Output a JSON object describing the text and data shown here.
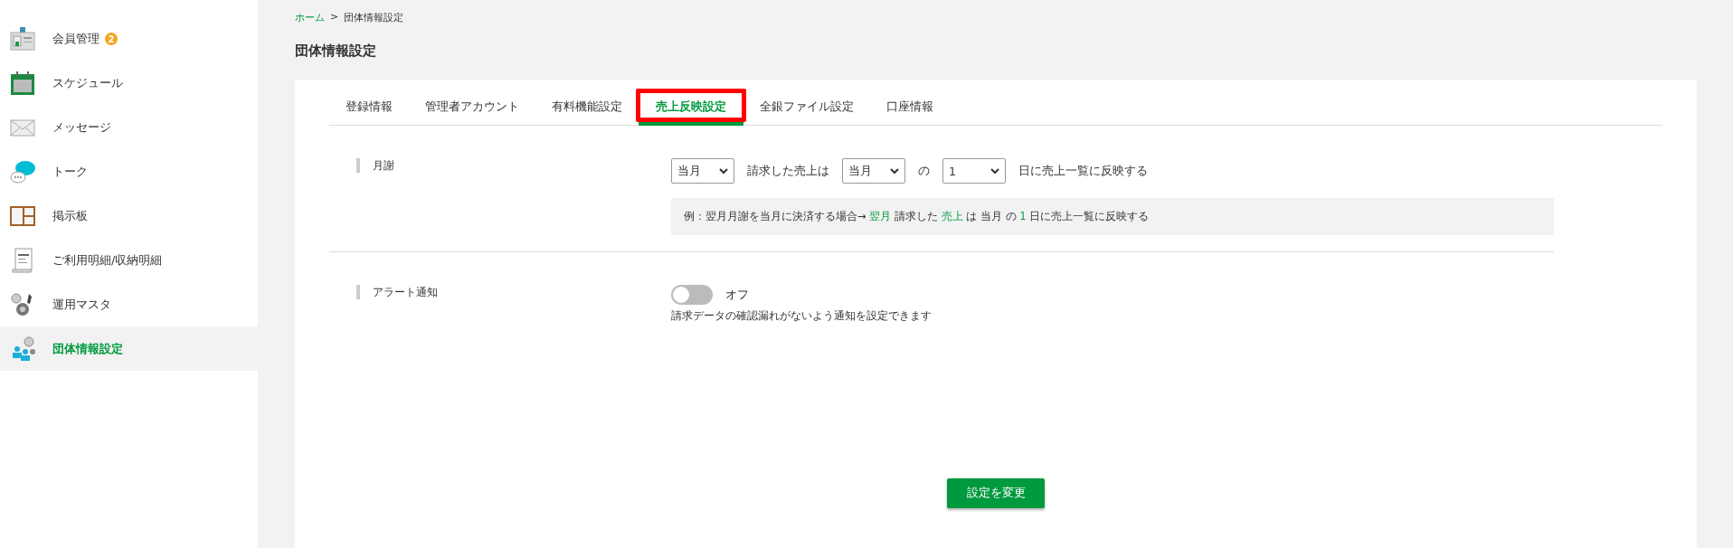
{
  "sidebar": {
    "items": [
      {
        "kind": "idcard",
        "label": "会員管理",
        "badge": "2",
        "selected": false
      },
      {
        "kind": "calendar",
        "label": "スケジュール",
        "selected": false
      },
      {
        "kind": "envelope",
        "label": "メッセージ",
        "selected": false
      },
      {
        "kind": "chat",
        "label": "トーク",
        "selected": false
      },
      {
        "kind": "board",
        "label": "掲示板",
        "selected": false
      },
      {
        "kind": "receipt",
        "label": "ご利用明細/収納明細",
        "selected": false
      },
      {
        "kind": "gears",
        "label": "運用マスタ",
        "selected": false
      },
      {
        "kind": "group",
        "label": "団体情報設定",
        "selected": true
      }
    ]
  },
  "breadcrumb": {
    "link": "ホーム",
    "separator": ">",
    "current": "団体情報設定"
  },
  "page_title": "団体情報設定",
  "tabs": [
    {
      "label": "登録情報",
      "selected": false,
      "highlighted": false
    },
    {
      "label": "管理者アカウント",
      "selected": false,
      "highlighted": false
    },
    {
      "label": "有料機能設定",
      "selected": false,
      "highlighted": false
    },
    {
      "label": "売上反映設定",
      "selected": true,
      "highlighted": true
    },
    {
      "label": "全銀ファイル設定",
      "selected": false,
      "highlighted": false
    },
    {
      "label": "口座情報",
      "selected": false,
      "highlighted": false
    }
  ],
  "monthly": {
    "label": "月謝",
    "select_1": "当月",
    "text_1": "請求した売上は",
    "select_2": "当月",
    "text_2": "の",
    "select_3": "1",
    "text_3": "日に売上一覧に反映する",
    "example": [
      {
        "text": "例：翌月月謝を当月に決済する場合→ ",
        "highlight": false
      },
      {
        "text": "翌月",
        "highlight": true
      },
      {
        "text": " 請求した ",
        "highlight": false
      },
      {
        "text": "売上",
        "highlight": true
      },
      {
        "text": " は 当月 の ",
        "highlight": false
      },
      {
        "text": "1",
        "highlight": true
      },
      {
        "text": " 日に売上一覧に反映する",
        "highlight": false
      }
    ]
  },
  "alert": {
    "label": "アラート通知",
    "on": false,
    "state_text": "オフ",
    "description": "請求データの確認漏れがないよう通知を設定できます"
  },
  "submit_button": "設定を変更"
}
